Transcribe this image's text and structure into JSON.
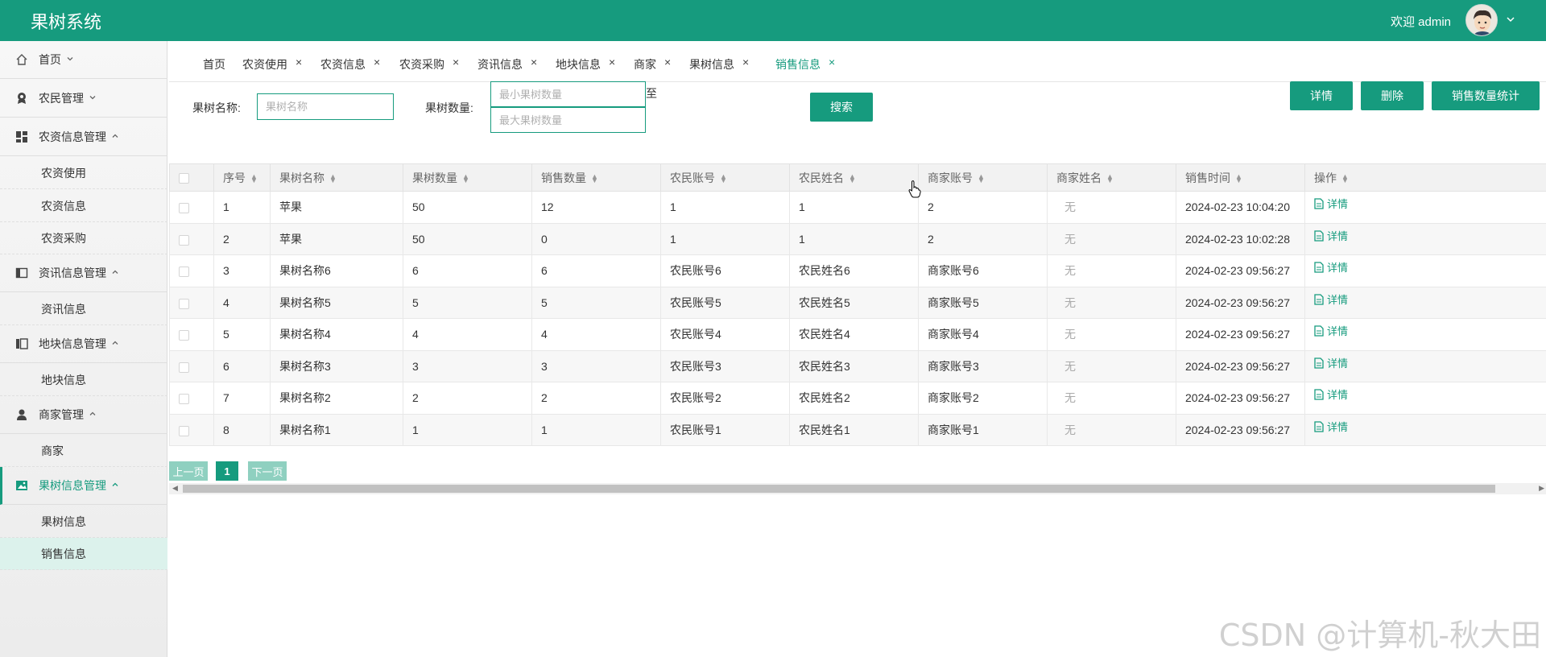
{
  "header": {
    "app_title": "果树系统",
    "welcome": "欢迎 admin"
  },
  "sidebar": {
    "groups": [
      {
        "label": "首页",
        "icon": "home-icon",
        "chevron": "﹀"
      },
      {
        "label": "农民管理",
        "icon": "farmer-icon",
        "chevron": "﹀"
      },
      {
        "label": "农资信息管理",
        "icon": "dashboard-icon",
        "chevron": "︿",
        "children": [
          "农资使用",
          "农资信息",
          "农资采购"
        ]
      },
      {
        "label": "资讯信息管理",
        "icon": "panel-icon",
        "chevron": "︿",
        "children": [
          "资讯信息"
        ]
      },
      {
        "label": "地块信息管理",
        "icon": "columns-icon",
        "chevron": "︿",
        "children": [
          "地块信息"
        ]
      },
      {
        "label": "商家管理",
        "icon": "user-icon",
        "chevron": "︿",
        "children": [
          "商家"
        ]
      },
      {
        "label": "果树信息管理",
        "icon": "image-icon",
        "chevron": "︿",
        "children": [
          "果树信息",
          "销售信息"
        ]
      }
    ]
  },
  "tabs": [
    "首页",
    "农资使用",
    "农资信息",
    "农资采购",
    "资讯信息",
    "地块信息",
    "商家",
    "果树信息",
    "销售信息"
  ],
  "search": {
    "name_label": "果树名称:",
    "name_placeholder": "果树名称",
    "qty_label": "果树数量:",
    "min_placeholder": "最小果树数量",
    "to": "至",
    "max_placeholder": "最大果树数量",
    "search_button": "搜索"
  },
  "actions": {
    "detail": "详情",
    "delete": "删除",
    "stats": "销售数量统计"
  },
  "table": {
    "columns": [
      "序号",
      "果树名称",
      "果树数量",
      "销售数量",
      "农民账号",
      "农民姓名",
      "商家账号",
      "商家姓名",
      "销售时间",
      "操作"
    ],
    "rows": [
      [
        "1",
        "苹果",
        "50",
        "12",
        "1",
        "1",
        "2",
        "无",
        "2024-02-23 10:04:20",
        "详情"
      ],
      [
        "2",
        "苹果",
        "50",
        "0",
        "1",
        "1",
        "2",
        "无",
        "2024-02-23 10:02:28",
        "详情"
      ],
      [
        "3",
        "果树名称6",
        "6",
        "6",
        "农民账号6",
        "农民姓名6",
        "商家账号6",
        "无",
        "2024-02-23 09:56:27",
        "详情"
      ],
      [
        "4",
        "果树名称5",
        "5",
        "5",
        "农民账号5",
        "农民姓名5",
        "商家账号5",
        "无",
        "2024-02-23 09:56:27",
        "详情"
      ],
      [
        "5",
        "果树名称4",
        "4",
        "4",
        "农民账号4",
        "农民姓名4",
        "商家账号4",
        "无",
        "2024-02-23 09:56:27",
        "详情"
      ],
      [
        "6",
        "果树名称3",
        "3",
        "3",
        "农民账号3",
        "农民姓名3",
        "商家账号3",
        "无",
        "2024-02-23 09:56:27",
        "详情"
      ],
      [
        "7",
        "果树名称2",
        "2",
        "2",
        "农民账号2",
        "农民姓名2",
        "商家账号2",
        "无",
        "2024-02-23 09:56:27",
        "详情"
      ],
      [
        "8",
        "果树名称1",
        "1",
        "1",
        "农民账号1",
        "农民姓名1",
        "商家账号1",
        "无",
        "2024-02-23 09:56:27",
        "详情"
      ]
    ]
  },
  "pager": {
    "prev": "上一页",
    "page": "1",
    "next": "下一页"
  },
  "watermark": "CSDN @计算机-秋大田",
  "colors": {
    "primary": "#169b7e",
    "active_sub": "#dcf2ec",
    "pager_light": "#8fd0c0"
  }
}
